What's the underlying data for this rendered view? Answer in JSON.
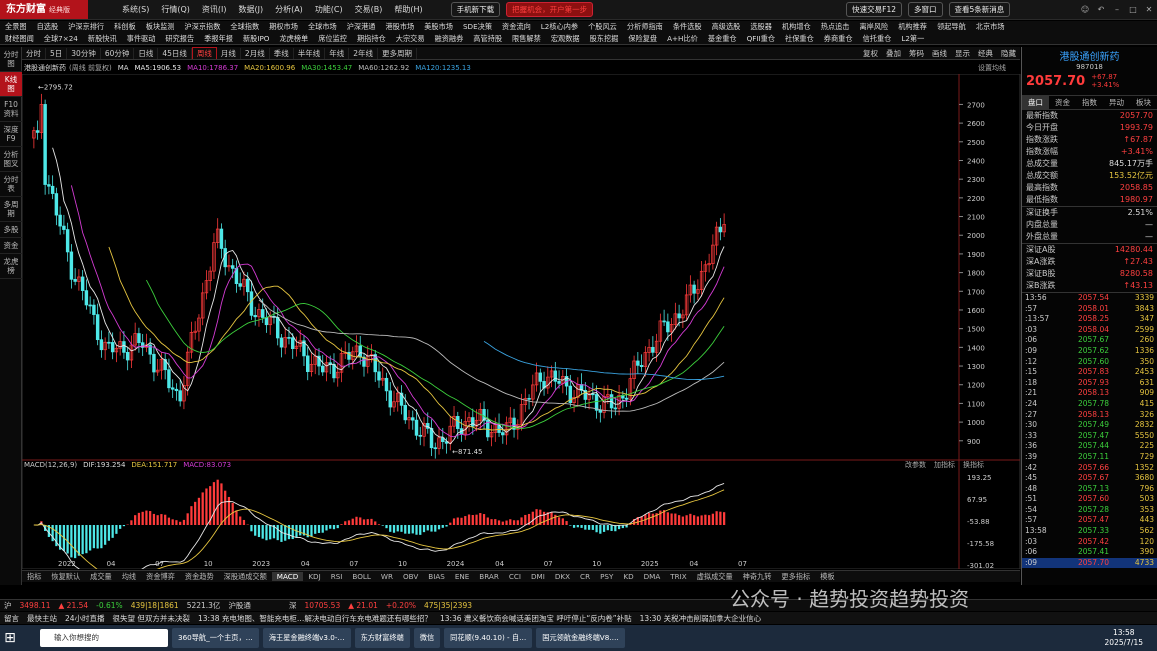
{
  "app": {
    "logo": "东方财富",
    "edition": "经典版"
  },
  "titlebar": {
    "menu": [
      "系统(S)",
      "行情(Q)",
      "资讯(I)",
      "数据(J)",
      "分析(A)",
      "功能(C)",
      "交易(B)",
      "帮助(H)"
    ],
    "phone": "手机新下载",
    "promo": "把握机会，开户第一步",
    "quick": "快速交易F12",
    "multi": "多窗口",
    "search": "查看5条新消息"
  },
  "nav1": [
    "全景图",
    "自选股",
    "沪深京排行",
    "科创板",
    "板块监测",
    "沪深京指数",
    "全球指数",
    "期权市场",
    "全球市场",
    "沪深港通",
    "港股市场",
    "美股市场",
    "SDE决策",
    "资金流向",
    "L2核心内参",
    "个股风云",
    "分析师指南",
    "条件选股",
    "高级选股",
    "选股器",
    "机构增仓",
    "热点追击",
    "离岸风险",
    "机构推荐",
    "领起导航",
    "北京市场"
  ],
  "nav2": [
    "财经图闻",
    "全球7×24",
    "新股快讯",
    "事件驱动",
    "研究报告",
    "季报年报",
    "新股IPO",
    "龙虎榜单",
    "席位监控",
    "期指持仓",
    "大宗交易",
    "融资融券",
    "高管持股",
    "限售解禁",
    "宏观数据",
    "股东挖掘",
    "保险复盘",
    "A+H比价",
    "基金重仓",
    "QFII重仓",
    "社保重仓",
    "券商重仓",
    "信托重仓",
    "L2第一"
  ],
  "leftbar": [
    "分时图",
    "K线图",
    "F10资料",
    "深度F9",
    "分析图叉",
    "分时表",
    "多周期",
    "多股",
    "资金",
    "龙虎榜"
  ],
  "periods": {
    "items": [
      "分时",
      "5日",
      "30分钟",
      "60分钟",
      "日线",
      "45日线",
      "周线",
      "月线",
      "2月线",
      "季线",
      "半年线",
      "年线",
      "2年线",
      "更多周期"
    ],
    "active": "周线",
    "right": [
      "复权",
      "叠加",
      "筹码",
      "画线",
      "显示",
      "经典",
      "隐藏"
    ]
  },
  "chart_title": "港股通创新药",
  "chart_title_opts": "(周线 前复权)",
  "ma": [
    {
      "label": "MA",
      "value": "",
      "color": "#dddddd"
    },
    {
      "label": "MA5:",
      "value": "1906.53",
      "color": "#e7e7e7"
    },
    {
      "label": "MA10:",
      "value": "1786.37",
      "color": "#d43bd4"
    },
    {
      "label": "MA20:",
      "value": "1600.96",
      "color": "#e7c640"
    },
    {
      "label": "MA30:",
      "value": "1453.47",
      "color": "#3ccf3c"
    },
    {
      "label": "MA60:",
      "value": "1262.92",
      "color": "#bbbbbb"
    },
    {
      "label": "MA120:",
      "value": "1235.13",
      "color": "#3aa3e0"
    }
  ],
  "settings_label": "设置均线",
  "macd": {
    "title": "MACD(12,26,9)",
    "dif": "DIF:193.254",
    "dea": "DEA:151.717",
    "macd": "MACD:83.073",
    "right": [
      "改参数",
      "加指标",
      "换指标"
    ]
  },
  "bottom_tabs": [
    "指标",
    "恢复默认",
    "成交量",
    "均线",
    "资金博弈",
    "资金趋势",
    "深股通成交额",
    "MACD",
    "KDJ",
    "RSI",
    "BOLL",
    "WR",
    "OBV",
    "BIAS",
    "ENE",
    "BRAR",
    "CCI",
    "DMI",
    "DKX",
    "CR",
    "PSY",
    "KD",
    "DMA",
    "TRIX",
    "虚拟成交量",
    "神奇九转",
    "更多指标",
    "模板"
  ],
  "bottom_active": "MACD",
  "chart_data": {
    "type": "candlestick",
    "title": "港股通创新药",
    "period": "weekly",
    "x_labels": [
      "2022",
      "04",
      "07",
      "10",
      "2023",
      "04",
      "07",
      "10",
      "2024",
      "04",
      "07",
      "10",
      "2025",
      "04",
      "07"
    ],
    "y_ticks": [
      2700,
      2600,
      2500,
      2400,
      2300,
      2200,
      2100,
      2000,
      1900,
      1800,
      1700,
      1600,
      1500,
      1400,
      1300,
      1200,
      1100,
      1000,
      900
    ],
    "ylim": [
      840,
      2820
    ],
    "annotations": [
      {
        "text": "2795.72",
        "type": "high"
      },
      {
        "text": "871.45",
        "type": "low"
      }
    ],
    "key_points": [
      {
        "t": "2022-01",
        "close": 2560
      },
      {
        "t": "2022-03",
        "close": 1850
      },
      {
        "t": "2022-05",
        "close": 1380
      },
      {
        "t": "2022-07",
        "close": 1420
      },
      {
        "t": "2022-10",
        "close": 1130
      },
      {
        "t": "2023-01",
        "close": 1980
      },
      {
        "t": "2023-03",
        "close": 1620
      },
      {
        "t": "2023-06",
        "close": 1430
      },
      {
        "t": "2023-08",
        "close": 1270
      },
      {
        "t": "2023-11",
        "close": 1390
      },
      {
        "t": "2024-01",
        "close": 1090
      },
      {
        "t": "2024-02",
        "close": 880
      },
      {
        "t": "2024-05",
        "close": 1020
      },
      {
        "t": "2024-08",
        "close": 940
      },
      {
        "t": "2024-10",
        "close": 1260
      },
      {
        "t": "2024-12",
        "close": 1150
      },
      {
        "t": "2025-01",
        "close": 1080
      },
      {
        "t": "2025-03",
        "close": 1420
      },
      {
        "t": "2025-05",
        "close": 1640
      },
      {
        "t": "2025-07",
        "close": 2057.7
      }
    ],
    "macd_ticks": [
      "193.25",
      "67.95",
      "-53.88",
      "-175.58",
      "-301.02"
    ]
  },
  "right_panel": {
    "name": "港股通创新药",
    "code": "987018",
    "price": "2057.70",
    "change": "+67.87",
    "pct": "+3.41%",
    "tabs": [
      "盘口",
      "资金",
      "指数",
      "异动",
      "板块"
    ],
    "rows": [
      {
        "k": "最新指数",
        "v": "2057.70",
        "c": "red"
      },
      {
        "k": "今日开盘",
        "v": "1993.79",
        "c": "red"
      },
      {
        "k": "指数涨跌",
        "v": "↑67.87",
        "c": "red"
      },
      {
        "k": "指数涨幅",
        "v": "+3.41%",
        "c": "red"
      },
      {
        "k": "总成交量",
        "v": "845.17万手",
        "c": "w"
      },
      {
        "k": "总成交额",
        "v": "153.52亿元",
        "c": "y"
      },
      {
        "k": "最高指数",
        "v": "2058.85",
        "c": "red"
      },
      {
        "k": "最低指数",
        "v": "1980.97",
        "c": "red"
      }
    ],
    "rows2": [
      {
        "k": "深证换手",
        "v": "2.51%",
        "c": "w"
      },
      {
        "k": "内盘总量",
        "v": "—",
        "c": "w"
      },
      {
        "k": "外盘总量",
        "v": "—",
        "c": "w"
      }
    ],
    "rows3": [
      {
        "k": "深证A股",
        "v": "14280.44",
        "c": "red"
      },
      {
        "k": "深A涨跌",
        "v": "↑27.43",
        "c": "red"
      },
      {
        "k": "深证B股",
        "v": "8280.58",
        "c": "red"
      },
      {
        "k": "深B涨跌",
        "v": "↑43.13",
        "c": "red"
      }
    ],
    "ticks": [
      [
        "13:56",
        "2057.54",
        "3339",
        "red"
      ],
      [
        ":57",
        "2058.01",
        "3843",
        "red"
      ],
      [
        ":13:57",
        "2058.25",
        "347",
        "red"
      ],
      [
        ":03",
        "2058.04",
        "2599",
        "red"
      ],
      [
        ":06",
        "2057.67",
        "260",
        "grn"
      ],
      [
        ":09",
        "2057.62",
        "1336",
        "grn"
      ],
      [
        ":12",
        "2057.60",
        "350",
        "grn"
      ],
      [
        ":15",
        "2057.83",
        "2453",
        "red"
      ],
      [
        ":18",
        "2057.93",
        "631",
        "red"
      ],
      [
        ":21",
        "2058.13",
        "909",
        "red"
      ],
      [
        ":24",
        "2057.78",
        "415",
        "grn"
      ],
      [
        ":27",
        "2058.13",
        "326",
        "red"
      ],
      [
        ":30",
        "2057.49",
        "2832",
        "grn"
      ],
      [
        ":33",
        "2057.47",
        "5550",
        "grn"
      ],
      [
        ":36",
        "2057.44",
        "225",
        "grn"
      ],
      [
        ":39",
        "2057.11",
        "729",
        "grn"
      ],
      [
        ":42",
        "2057.66",
        "1352",
        "red"
      ],
      [
        ":45",
        "2057.67",
        "3680",
        "red"
      ],
      [
        ":48",
        "2057.13",
        "796",
        "grn"
      ],
      [
        ":51",
        "2057.60",
        "503",
        "red"
      ],
      [
        ":54",
        "2057.28",
        "353",
        "grn"
      ],
      [
        ":57",
        "2057.47",
        "443",
        "red"
      ],
      [
        "13:58",
        "2057.33",
        "562",
        "grn"
      ],
      [
        ":03",
        "2057.42",
        "120",
        "red"
      ],
      [
        ":06",
        "2057.41",
        "390",
        "grn"
      ],
      [
        ":09",
        "2057.70",
        "4733",
        "red"
      ]
    ]
  },
  "status": {
    "sh_label": "沪",
    "sh": "3498.11",
    "sh_chg": "▲ 21.54",
    "sh_pct": "-0.61%",
    "sh_amt": "439|18|1861",
    "sh_vol": "5221.3亿",
    "hk_label": "沪股通",
    "sz_label": "深",
    "sz": "10705.53",
    "sz_chg": "▲ 21.01",
    "sz_pct": "+0.20%",
    "sz_amt": "475|35|2393"
  },
  "news": [
    "留言",
    "最快主站",
    "24小时直播",
    "很失望 但双方并未决裂",
    "13:38 充电地图、智能充电柜…解决电动自行车充电难题还有哪些招？",
    "13:36 遭义餐饮商会喊话美团淘宝 呼吁停止“反内卷”补贴",
    "13:30 关税冲击削弱加拿大企业信心"
  ],
  "watermark": "公众号 · 趋势投资趋势投资",
  "taskbar": {
    "search": "输入你想搜的",
    "apps": [
      "360导航_一个主页，…",
      "海王星金融终端v3.0-…",
      "东方财富终端",
      "微信",
      "同花顺(9.40.10) - 自…",
      "国元领航金融终端V8.…"
    ],
    "time": "13:58",
    "date": "2025/7/15"
  }
}
